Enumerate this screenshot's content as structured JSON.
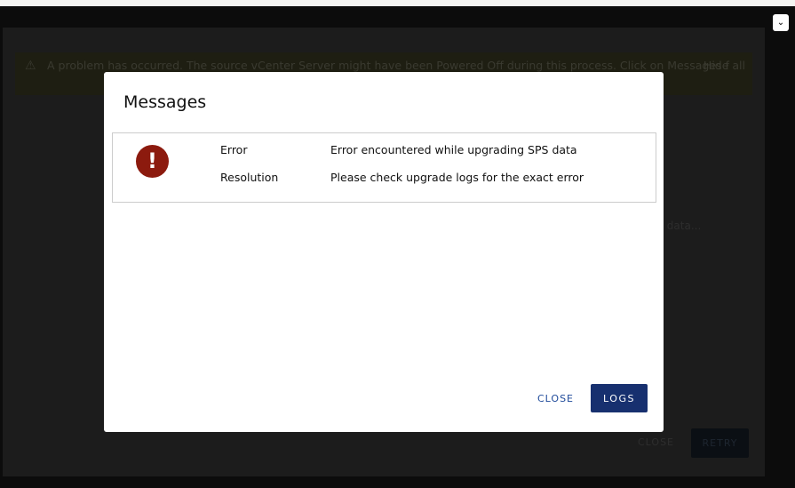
{
  "background": {
    "alert_text": "A problem has occurred. The source vCenter Server might have been Powered Off during this process. Click on Messages f",
    "hide_all": "Hide all",
    "progress_text": "ce data...",
    "close_label": "CLOSE",
    "retry_label": "RETRY"
  },
  "modal": {
    "title": "Messages",
    "icon": "error-exclamation-icon",
    "rows": [
      {
        "label": "Error",
        "value": "Error encountered while upgrading SPS data"
      },
      {
        "label": "Resolution",
        "value": "Please check upgrade logs for the exact error"
      }
    ],
    "close_label": "CLOSE",
    "logs_label": "LOGS"
  },
  "colors": {
    "primary": "#17306f",
    "error": "#8c1a0e",
    "link": "#1f4a9a"
  }
}
